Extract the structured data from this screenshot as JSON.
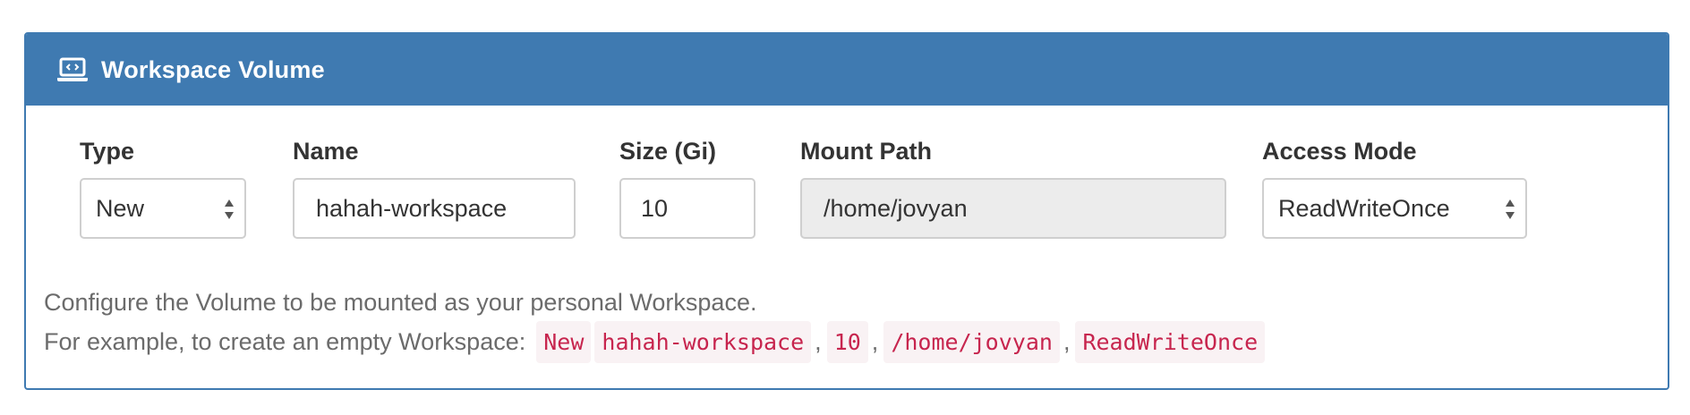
{
  "panel": {
    "title": "Workspace Volume",
    "icon": "laptop-code-icon",
    "header_color": "#3f7ab1"
  },
  "fields": {
    "type": {
      "label": "Type",
      "value": "New"
    },
    "name": {
      "label": "Name",
      "value": "hahah-workspace"
    },
    "size": {
      "label": "Size (Gi)",
      "value": "10"
    },
    "mount_path": {
      "label": "Mount Path",
      "value": "/home/jovyan"
    },
    "access_mode": {
      "label": "Access Mode",
      "value": "ReadWriteOnce"
    }
  },
  "help": {
    "line1": "Configure the Volume to be mounted as your personal Workspace.",
    "line2_prefix": "For example, to create an empty Workspace:",
    "example": [
      "New",
      "hahah-workspace",
      "10",
      "/home/jovyan",
      "ReadWriteOnce"
    ],
    "separator": ","
  }
}
